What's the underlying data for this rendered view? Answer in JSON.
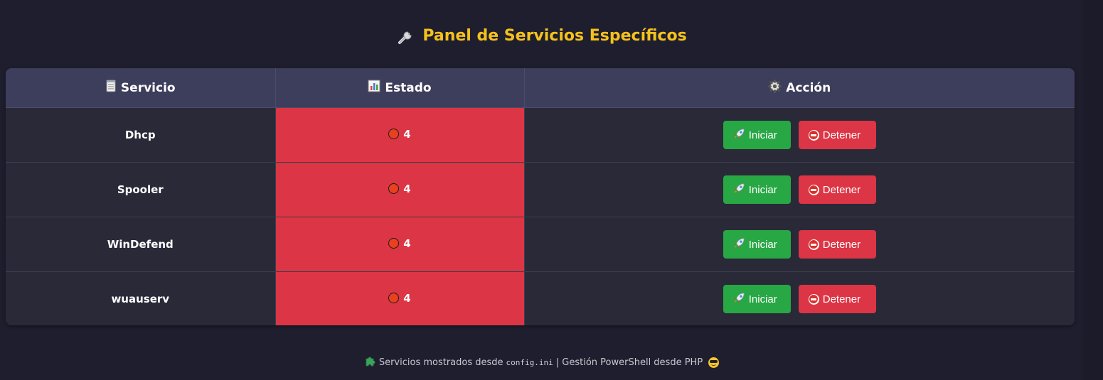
{
  "page": {
    "title": "Panel de Servicios Específicos",
    "title_icon": "wrench-icon"
  },
  "table": {
    "headers": {
      "service": "Servicio",
      "status": "Estado",
      "action": "Acción"
    },
    "header_icons": {
      "service": "notepad-icon",
      "status": "bar-chart-icon",
      "action": "gear-icon"
    },
    "rows": [
      {
        "service": "Dhcp",
        "status": "4"
      },
      {
        "service": "Spooler",
        "status": "4"
      },
      {
        "service": "WinDefend",
        "status": "4"
      },
      {
        "service": "wuauserv",
        "status": "4"
      }
    ],
    "status_icon": "red-circle-icon"
  },
  "buttons": {
    "start_label": "Iniciar",
    "start_icon": "rocket-icon",
    "stop_label": "Detener",
    "stop_icon": "no-entry-icon"
  },
  "footer": {
    "icon": "puzzle-piece-icon",
    "text_before": "Servicios mostrados desde",
    "code": "config.ini",
    "text_after": "| Gestión PowerShell desde PHP",
    "end_icon": "smiling-face-with-sunglasses-icon"
  },
  "colors": {
    "background": "#1f1e2e",
    "title": "#f5c21b",
    "header_bg": "#3d3d5c",
    "status_stopped": "#dc3545",
    "start_button": "#28a745",
    "stop_button": "#dc3545"
  }
}
